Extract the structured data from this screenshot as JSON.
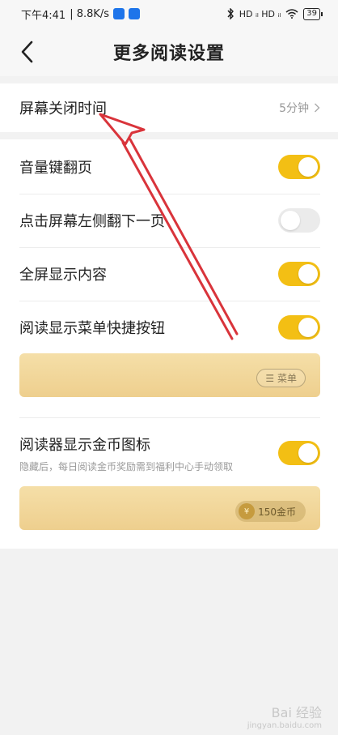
{
  "status_bar": {
    "time": "下午4:41",
    "speed": "| 8.8K/s",
    "signal": "HD ᵢₗ HD ᵢₗ",
    "battery": "39"
  },
  "header": {
    "title": "更多阅读设置"
  },
  "screen_off": {
    "label": "屏幕关闭时间",
    "value": "5分钟"
  },
  "settings": [
    {
      "label": "音量键翻页",
      "enabled": true
    },
    {
      "label": "点击屏幕左侧翻下一页",
      "enabled": false
    },
    {
      "label": "全屏显示内容",
      "enabled": true
    },
    {
      "label": "阅读显示菜单快捷按钮",
      "enabled": true
    }
  ],
  "menu_preview": {
    "pill_label": "☰ 菜单"
  },
  "coin_setting": {
    "label": "阅读器显示金币图标",
    "subtitle": "隐藏后，每日阅读金币奖励需到福利中心手动领取",
    "enabled": true
  },
  "coin_preview": {
    "symbol": "¥",
    "amount": "150金币"
  },
  "watermark": {
    "line1": "Bai 经验",
    "line2": "jingyan.baidu.com"
  },
  "colors": {
    "accent": "#f3bf14",
    "arrow": "#d9343b"
  }
}
